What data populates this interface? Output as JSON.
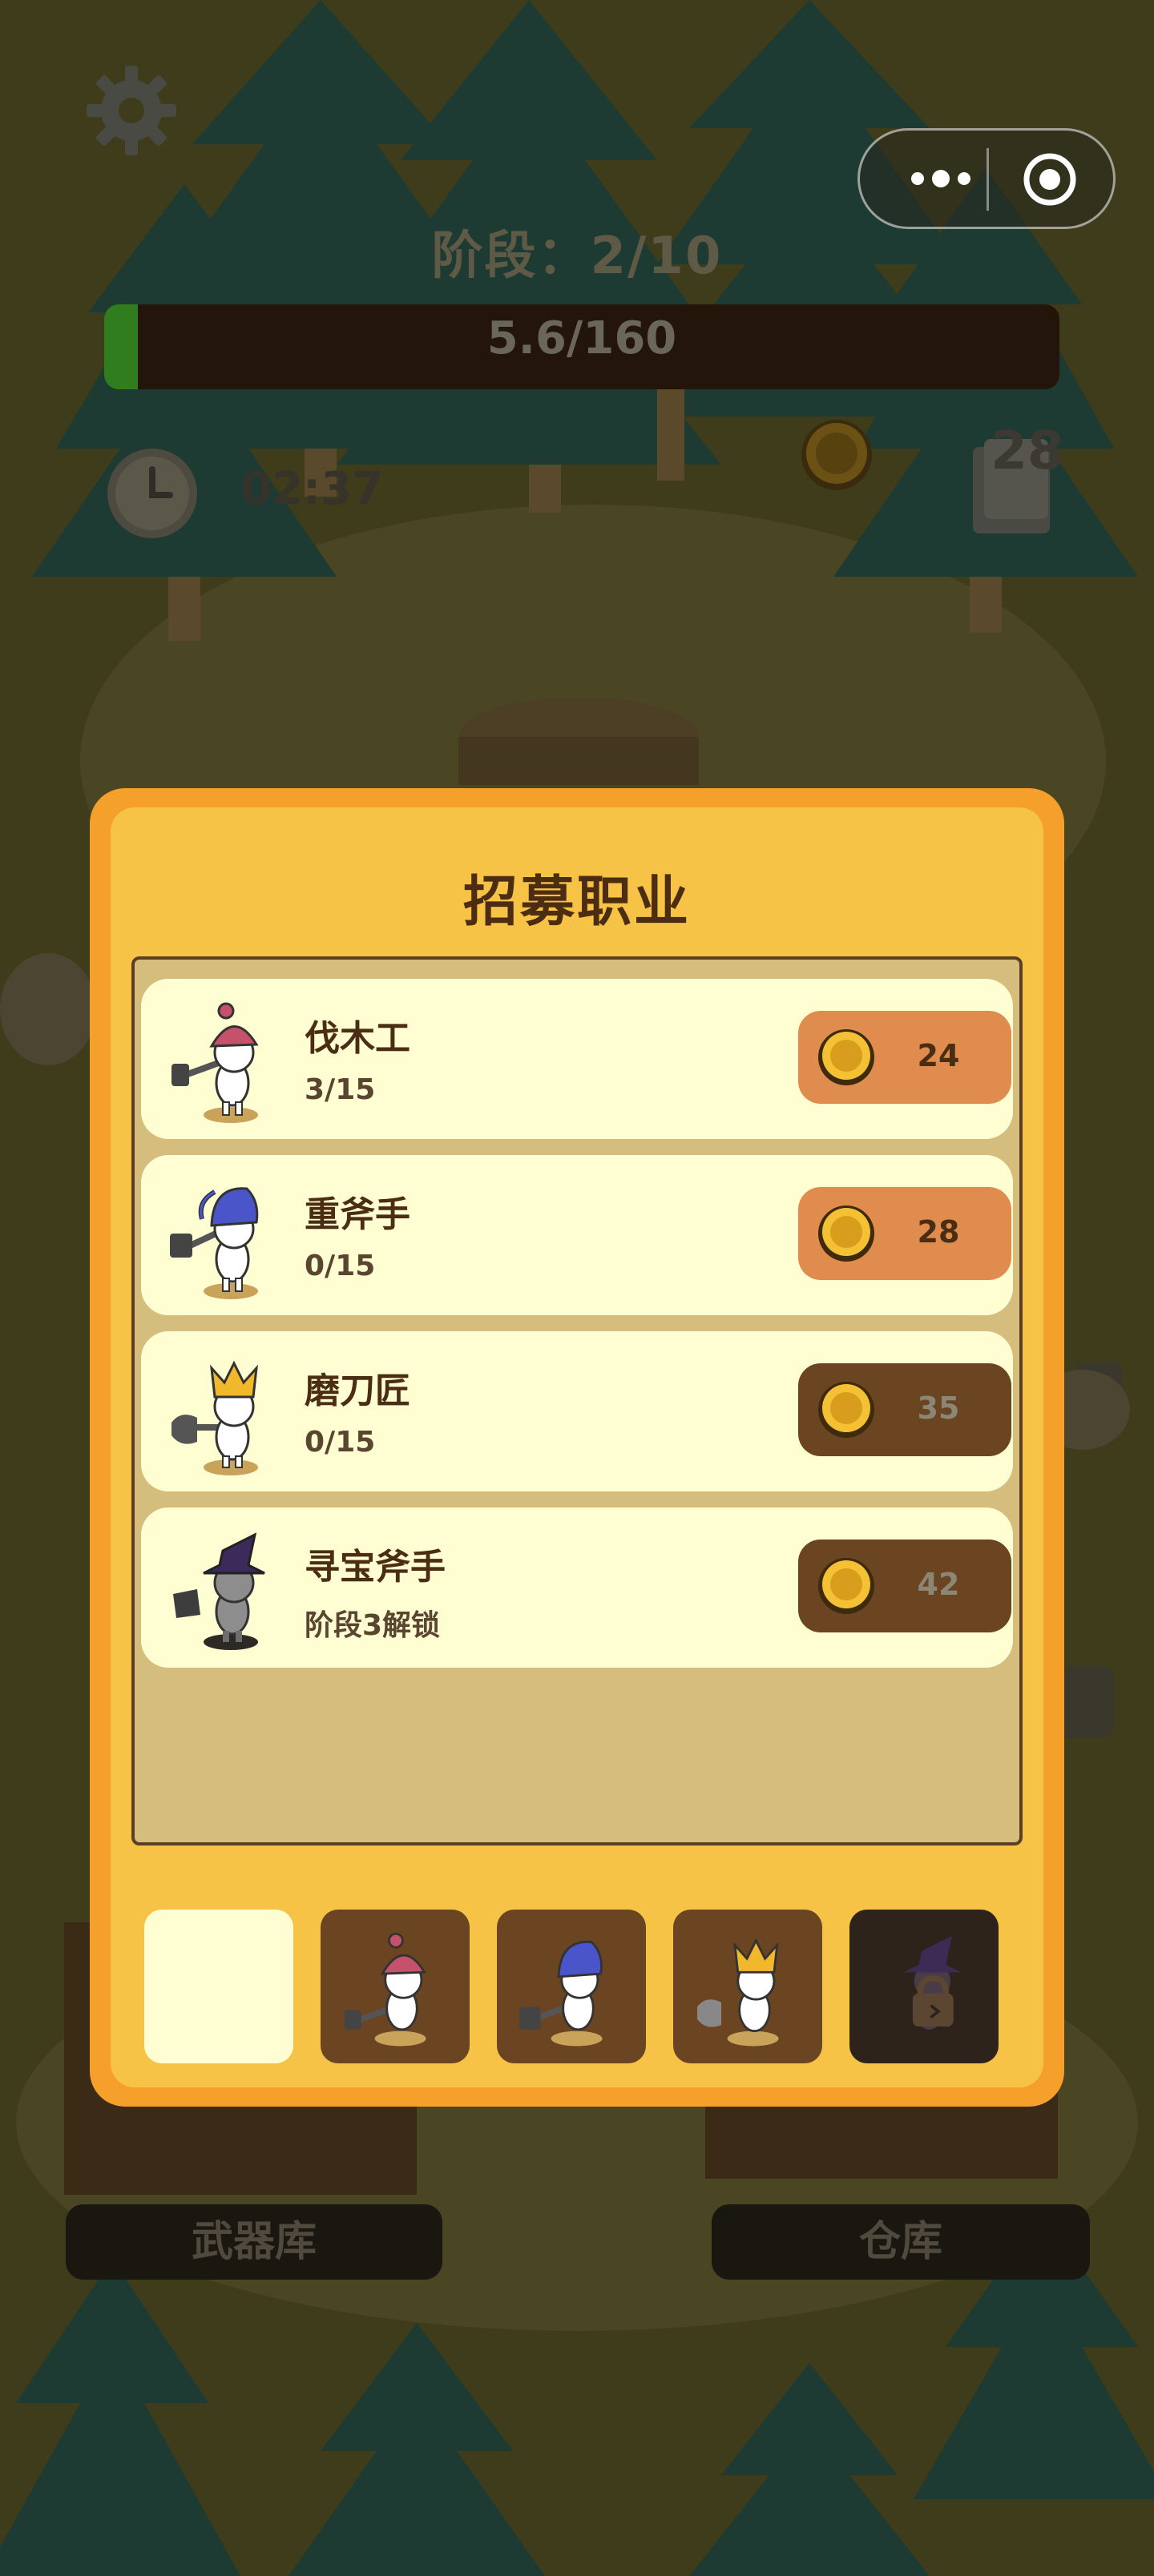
{
  "hud": {
    "stage_label": "阶段：2/10",
    "progress_text": "5.6/160",
    "progress_fraction": 0.035,
    "timer": "02:37",
    "resource_count": "28",
    "icons": [
      "gear-icon",
      "more-dots-icon",
      "target-icon",
      "clock-icon",
      "coin-icon",
      "card-icon"
    ]
  },
  "modal": {
    "title": "招募职业",
    "items": [
      {
        "name": "伐木工",
        "sub": "3/15",
        "price": "24",
        "enabled": true,
        "hat": "red-cone"
      },
      {
        "name": "重斧手",
        "sub": "0/15",
        "price": "28",
        "enabled": true,
        "hat": "blue-cap"
      },
      {
        "name": "磨刀匠",
        "sub": "0/15",
        "price": "35",
        "enabled": false,
        "hat": "gold-crown"
      },
      {
        "name": "寻宝斧手",
        "sub": "阶段3解锁",
        "price": "42",
        "enabled": false,
        "hat": "purple-witch"
      }
    ],
    "slots": [
      "empty",
      "red-cone",
      "blue-cap",
      "gold-crown",
      "locked"
    ]
  },
  "bottom": {
    "armory": "武器库",
    "warehouse": "仓库"
  },
  "colors": {
    "modal_outer": "#f5a02a",
    "modal_inner": "#f6c347",
    "row_bg": "#fffdd2",
    "btn_enabled": "#e08c4f",
    "btn_disabled": "#6b4521",
    "title_text": "#4d2d12"
  }
}
